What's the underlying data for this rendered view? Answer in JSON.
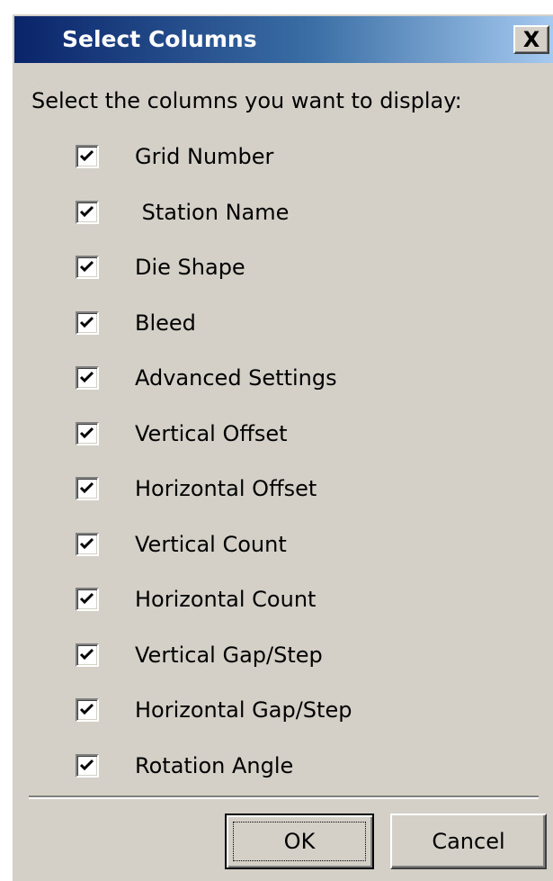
{
  "window": {
    "title": "Select Columns",
    "close_label": "X"
  },
  "instruction": "Select the columns you want to display:",
  "columns": [
    {
      "label": "Grid Number",
      "checked": true
    },
    {
      "label": " Station Name",
      "checked": true
    },
    {
      "label": "Die Shape",
      "checked": true
    },
    {
      "label": "Bleed",
      "checked": true
    },
    {
      "label": "Advanced Settings",
      "checked": true
    },
    {
      "label": "Vertical Offset",
      "checked": true
    },
    {
      "label": "Horizontal Offset",
      "checked": true
    },
    {
      "label": "Vertical Count",
      "checked": true
    },
    {
      "label": "Horizontal Count",
      "checked": true
    },
    {
      "label": "Vertical Gap/Step",
      "checked": true
    },
    {
      "label": "Horizontal Gap/Step",
      "checked": true
    },
    {
      "label": "Rotation Angle",
      "checked": true
    }
  ],
  "buttons": {
    "ok_label": "OK",
    "cancel_label": "Cancel"
  },
  "colors": {
    "face": "#d4d0c8",
    "title_start": "#0a246a",
    "title_end": "#a6caf0"
  }
}
